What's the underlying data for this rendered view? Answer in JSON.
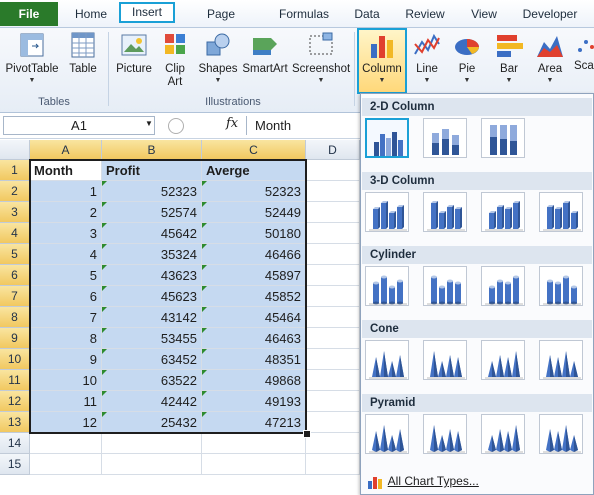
{
  "tabs": [
    {
      "label": "File"
    },
    {
      "label": "Home"
    },
    {
      "label": "Insert"
    },
    {
      "label": "Page Layout"
    },
    {
      "label": "Formulas"
    },
    {
      "label": "Data"
    },
    {
      "label": "Review"
    },
    {
      "label": "View"
    },
    {
      "label": "Developer"
    }
  ],
  "ribbon": {
    "pivot_label": "PivotTable",
    "table_label": "Table",
    "tables_group": "Tables",
    "picture_label": "Picture",
    "clipart_label1": "Clip",
    "clipart_label2": "Art",
    "shapes_label": "Shapes",
    "smartart_label": "SmartArt",
    "screenshot_label": "Screenshot",
    "illustrations_group": "Illustrations",
    "column_label": "Column",
    "line_label": "Line",
    "pie_label": "Pie",
    "bar_label": "Bar",
    "area_label": "Area",
    "sca_label": "Sca"
  },
  "formula_bar": {
    "name_box": "A1",
    "fx": "fx",
    "formula": "Month"
  },
  "grid": {
    "columns": [
      "A",
      "B",
      "C",
      "D"
    ],
    "rows": [
      "1",
      "2",
      "3",
      "4",
      "5",
      "6",
      "7",
      "8",
      "9",
      "10",
      "11",
      "12",
      "13",
      "14",
      "15"
    ],
    "headers": [
      "Month",
      "Profit",
      "Averge"
    ],
    "data": [
      [
        "1",
        "52323",
        "52323"
      ],
      [
        "2",
        "52574",
        "52449"
      ],
      [
        "3",
        "45642",
        "50180"
      ],
      [
        "4",
        "35324",
        "46466"
      ],
      [
        "5",
        "43623",
        "45897"
      ],
      [
        "6",
        "45623",
        "45852"
      ],
      [
        "7",
        "43142",
        "45464"
      ],
      [
        "8",
        "53455",
        "46463"
      ],
      [
        "9",
        "63452",
        "48351"
      ],
      [
        "10",
        "63522",
        "49868"
      ],
      [
        "11",
        "42442",
        "49193"
      ],
      [
        "12",
        "25432",
        "47213"
      ]
    ]
  },
  "dropdown": {
    "sections": [
      "2-D Column",
      "3-D Column",
      "Cylinder",
      "Cone",
      "Pyramid"
    ],
    "all_chart_types": "All Chart Types..."
  },
  "colors": {
    "file_tab": "#2a7a2a",
    "highlight": "#1aa0d6",
    "selection": "#c5d9f1"
  }
}
